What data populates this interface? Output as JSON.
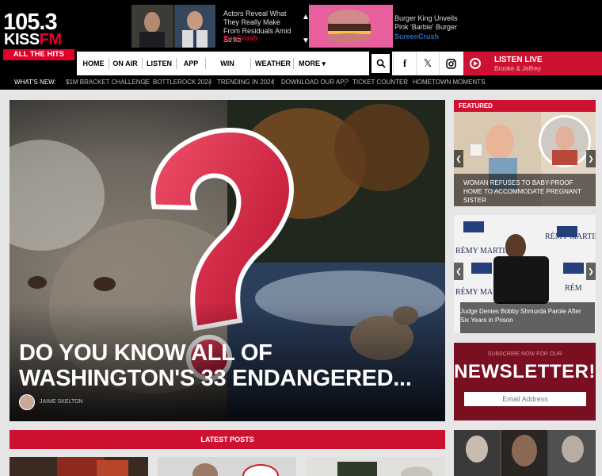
{
  "logo": {
    "number": "105.3",
    "kiss": "KISS",
    "fm": "FM",
    "tagline": "ALL THE HITS"
  },
  "promos": [
    {
      "title": "Actors Reveal What They Really Make From Residuals Amid Strike",
      "source": "PopCrush",
      "source_color": "#e0002a"
    },
    {
      "title": "Burger King Unveils Pink 'Barbie' Burger",
      "source": "ScreenCrush",
      "source_color": "#1e73be"
    }
  ],
  "nav": {
    "items": [
      "HOME",
      "ON AIR",
      "LISTEN",
      "APP",
      "WIN STUFF",
      "WEATHER",
      "MORE"
    ],
    "icons": [
      "search-icon",
      "facebook-icon",
      "x-icon",
      "instagram-icon"
    ],
    "listen_live": "LISTEN LIVE",
    "show": "Brooke & Jeffrey"
  },
  "whats_new": {
    "label": "WHAT'S NEW:",
    "items": [
      "$1M BRACKET CHALLENGE",
      "BOTTLEROCK 2024",
      "TRENDING IN 2024",
      "DOWNLOAD OUR APP",
      "TICKET COUNTER",
      "HOMETOWN MOMENTS"
    ]
  },
  "hero": {
    "title": "DO YOU KNOW ALL OF WASHINGTON'S 33 ENDANGERED...",
    "author": "JAIME SKELTON"
  },
  "latest_posts": "LATEST POSTS",
  "sidebar": {
    "featured": "FEATURED",
    "cards": [
      {
        "caption": "WOMAN REFUSES TO BABY-PROOF HOME TO ACCOMMODATE PREGNANT SISTER"
      },
      {
        "caption": "Judge Denies Bobby Shmurda Parole After Six Years in Prison"
      }
    ],
    "newsletter": {
      "subscribe": "SUBSCRIBE NOW FOR OUR",
      "title": "NEWSLETTER!",
      "placeholder": "Email Address"
    }
  },
  "colors": {
    "brand_red": "#cf1131",
    "header_bg": "#000000",
    "newsletter_bg": "#7a0f22"
  }
}
